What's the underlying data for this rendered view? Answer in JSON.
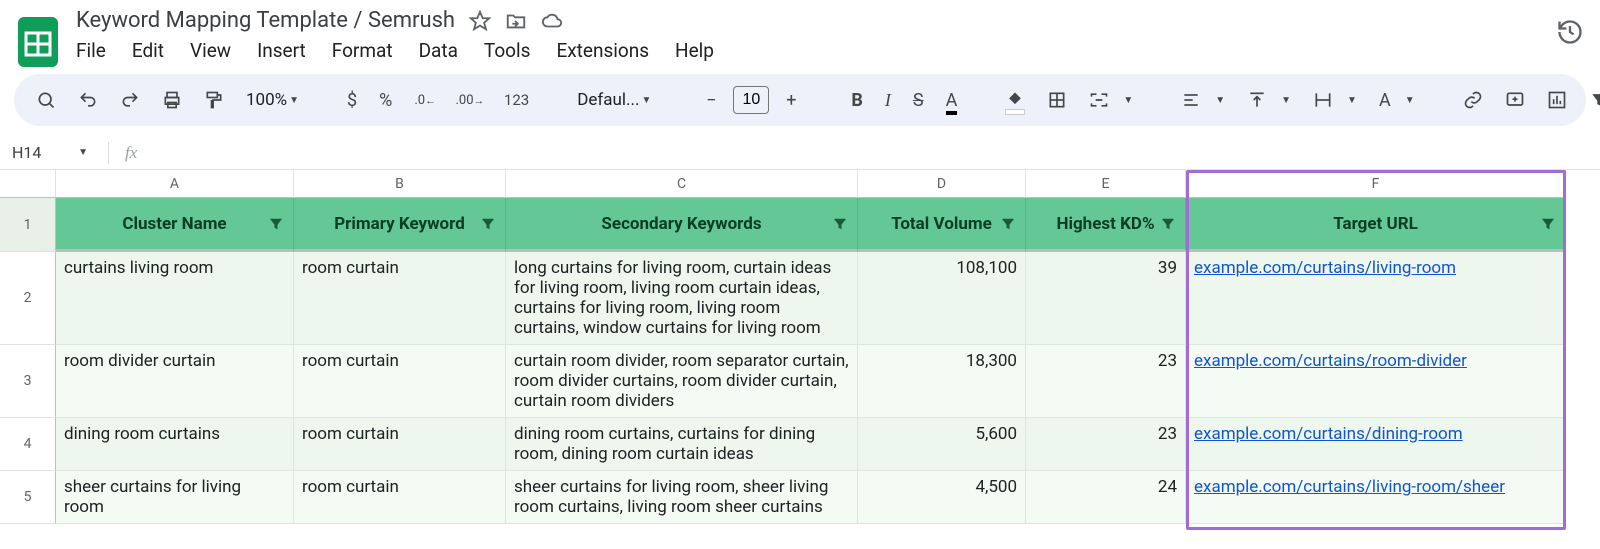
{
  "doc": {
    "title": "Keyword Mapping Template / Semrush"
  },
  "menu": {
    "file": "File",
    "edit": "Edit",
    "view": "View",
    "insert": "Insert",
    "format": "Format",
    "data": "Data",
    "tools": "Tools",
    "extensions": "Extensions",
    "help": "Help"
  },
  "toolbar": {
    "zoom": "100%",
    "font": "Defaul...",
    "fontsize": "10",
    "num": "123"
  },
  "namebox": "H14",
  "columns": {
    "A": "A",
    "B": "B",
    "C": "C",
    "D": "D",
    "E": "E",
    "F": "F"
  },
  "headers": {
    "cluster": "Cluster Name",
    "primary": "Primary Keyword",
    "secondary": "Secondary Keywords",
    "volume": "Total Volume",
    "kd": "Highest KD%",
    "url": "Target URL"
  },
  "rows": [
    {
      "n": "2",
      "cluster": "curtains living room",
      "primary": "room curtain",
      "secondary": "long curtains for living room, curtain ideas for living room, living room curtain ideas, curtains for living room, living room curtains, window curtains for living room",
      "volume": "108,100",
      "kd": "39",
      "url": "example.com/curtains/living-room"
    },
    {
      "n": "3",
      "cluster": "room divider curtain",
      "primary": "room curtain",
      "secondary": "curtain room divider, room separator curtain, room divider curtains, room divider curtain, curtain room dividers",
      "volume": "18,300",
      "kd": "23",
      "url": "example.com/curtains/room-divider"
    },
    {
      "n": "4",
      "cluster": "dining room curtains",
      "primary": "room curtain",
      "secondary": "dining room curtains, curtains for dining room, dining room curtain ideas",
      "volume": "5,600",
      "kd": "23",
      "url": "example.com/curtains/dining-room"
    },
    {
      "n": "5",
      "cluster": "sheer curtains for living room",
      "primary": "room curtain",
      "secondary": "sheer curtains for living room, sheer living room curtains, living room sheer curtains",
      "volume": "4,500",
      "kd": "24",
      "url": "example.com/curtains/living-room/sheer"
    }
  ]
}
